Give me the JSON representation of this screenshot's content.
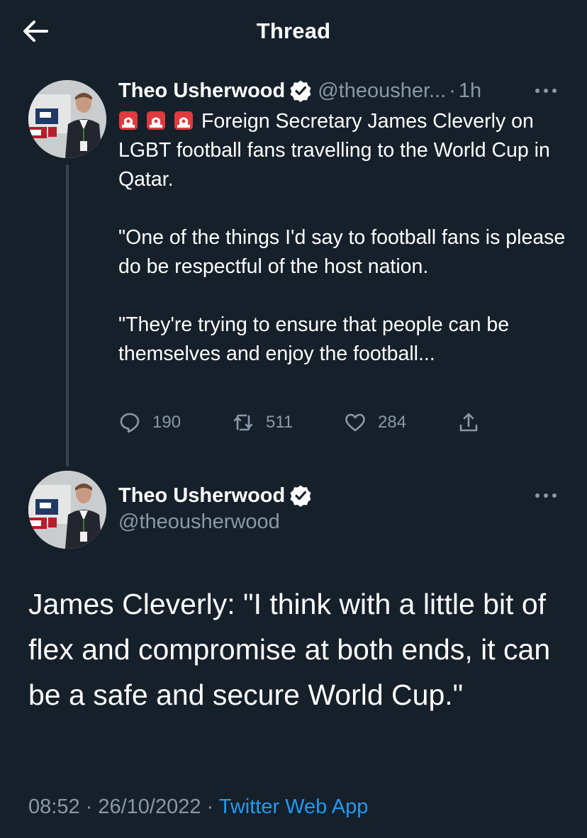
{
  "header": {
    "title": "Thread",
    "back_icon": "arrow-left-icon"
  },
  "tweet1": {
    "display_name": "Theo Usherwood",
    "handle": "@theousher...",
    "separator": "·",
    "time": "1h",
    "verified_icon": "verified-badge-icon",
    "more_icon": "more-horizontal-icon",
    "siren_icon": "police-siren-emoji",
    "paragraphs": [
      "Foreign Secretary James Cleverly on LGBT football fans travelling to the World Cup in Qatar.",
      "\"One of the things I'd say to football fans is please do be respectful of the host nation.",
      "\"They're trying to ensure that people can be themselves and enjoy the football..."
    ],
    "replies": "190",
    "retweets": "511",
    "likes": "284"
  },
  "tweet2": {
    "display_name": "Theo Usherwood",
    "handle": "@theousherwood",
    "verified_icon": "verified-badge-icon",
    "more_icon": "more-horizontal-icon",
    "text": "James Cleverly: \"I think with a little bit of flex and compromise at both ends, it can be a safe and secure World Cup.\"",
    "timestamp": "08:52 · 26/10/2022",
    "separator": " · ",
    "source": "Twitter Web App"
  },
  "colors": {
    "background": "#15202b",
    "text_primary": "#ffffff",
    "text_secondary": "#8b98a5",
    "link": "#1d9bf0",
    "thread_line": "#38444d"
  }
}
